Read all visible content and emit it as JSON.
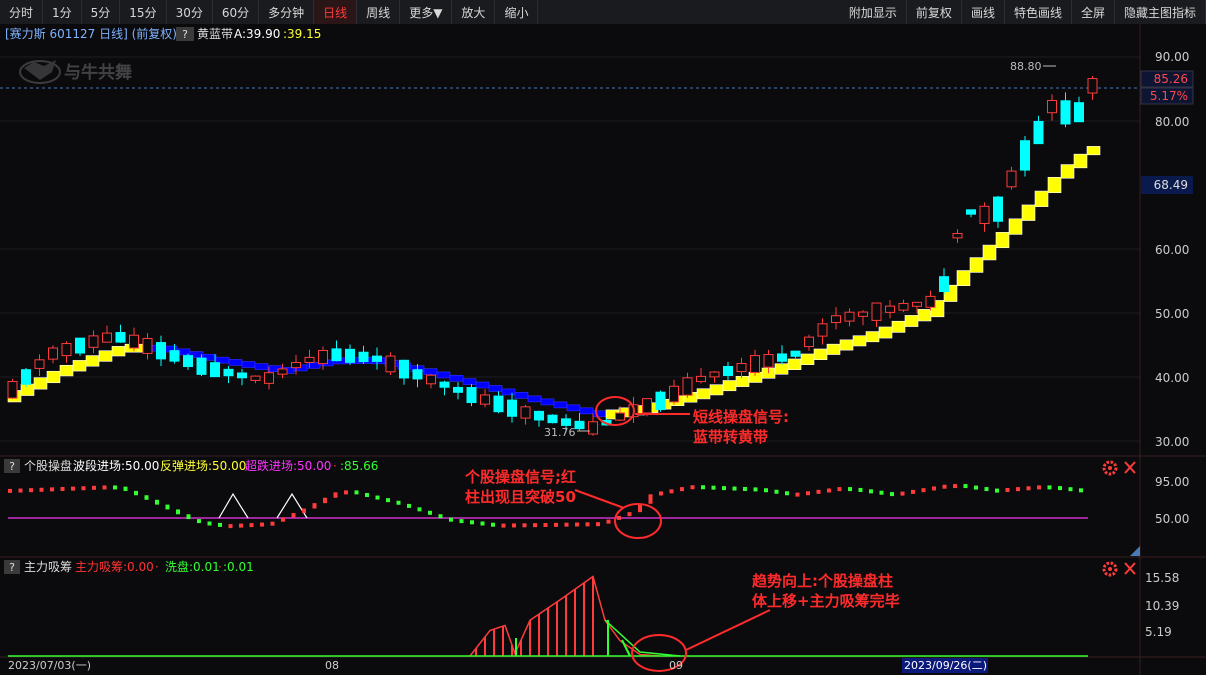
{
  "toolbar": {
    "left": [
      "分时",
      "1分",
      "5分",
      "15分",
      "30分",
      "60分",
      "多分钟",
      "日线",
      "周线",
      "更多▼",
      "放大",
      "缩小"
    ],
    "active": "日线",
    "right": [
      "附加显示",
      "前复权",
      "画线",
      "特色画线",
      "全屏",
      "隐藏主图指标"
    ]
  },
  "main": {
    "stock_info": "[赛力斯 601127 日线] (前复权)",
    "indicator_name": "黄蓝带",
    "value_a": "A:39.90",
    "value_b": ":39.15",
    "watermark": "与牛共舞",
    "price_ticks": [
      "90.00",
      "80.00",
      "60.00",
      "50.00",
      "40.00",
      "30.00"
    ],
    "current_price": "85.26",
    "current_pct": "5.17%",
    "right_marker": "68.49",
    "high_label": "88.80",
    "low_label": "31.76",
    "annotation_line1": "短线操盘信号:",
    "annotation_line2": "蓝带转黄带"
  },
  "panel2": {
    "title": "个股操盘",
    "label1": "波段进场:50.00",
    "label2": "反弹进场:50.00",
    "label3": "超跌进场:50.00",
    "label4": ":85.66",
    "ticks": [
      "95.00",
      "50.00"
    ],
    "annotation_line1": "个股操盘信号;红",
    "annotation_line2": "柱出现且突破50"
  },
  "panel3": {
    "title": "主力吸筹",
    "label1": "主力吸筹:0.00",
    "label2": "洗盘:0.01",
    "label3": ":0.01",
    "ticks": [
      "15.58",
      "10.39",
      "5.19"
    ],
    "annotation_line1": "趋势向上:个股操盘柱",
    "annotation_line2": "体上移+主力吸筹完毕"
  },
  "dates": {
    "start": "2023/07/03(一)",
    "m08": "08",
    "m09": "09",
    "highlight": "2023/09/26(二)"
  },
  "colors": {
    "up": "#ff3b3b",
    "down": "#00ffff",
    "yellow_band": "#ffff00",
    "blue_band": "#0000ff",
    "purple_line": "#cc33cc",
    "green": "#33ff33",
    "annotation": "#ff3b3b"
  }
}
